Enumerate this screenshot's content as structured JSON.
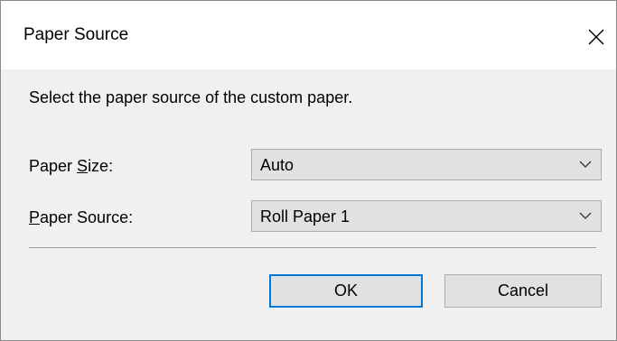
{
  "dialog": {
    "title": "Paper Source",
    "close_icon": "close-icon"
  },
  "instruction": "Select the paper source of the custom paper.",
  "fields": {
    "paper_size": {
      "label_pre": "Paper ",
      "label_accel": "S",
      "label_post": "ize:",
      "value": "Auto",
      "icon": "chevron-down-icon"
    },
    "paper_source": {
      "label_pre": "",
      "label_accel": "P",
      "label_post": "aper Source:",
      "value": "Roll Paper 1",
      "icon": "chevron-down-icon"
    }
  },
  "buttons": {
    "ok": "OK",
    "cancel": "Cancel"
  },
  "colors": {
    "client_background": "#f0f0f0",
    "button_face": "#e1e1e1",
    "default_button_border": "#0078d7"
  }
}
